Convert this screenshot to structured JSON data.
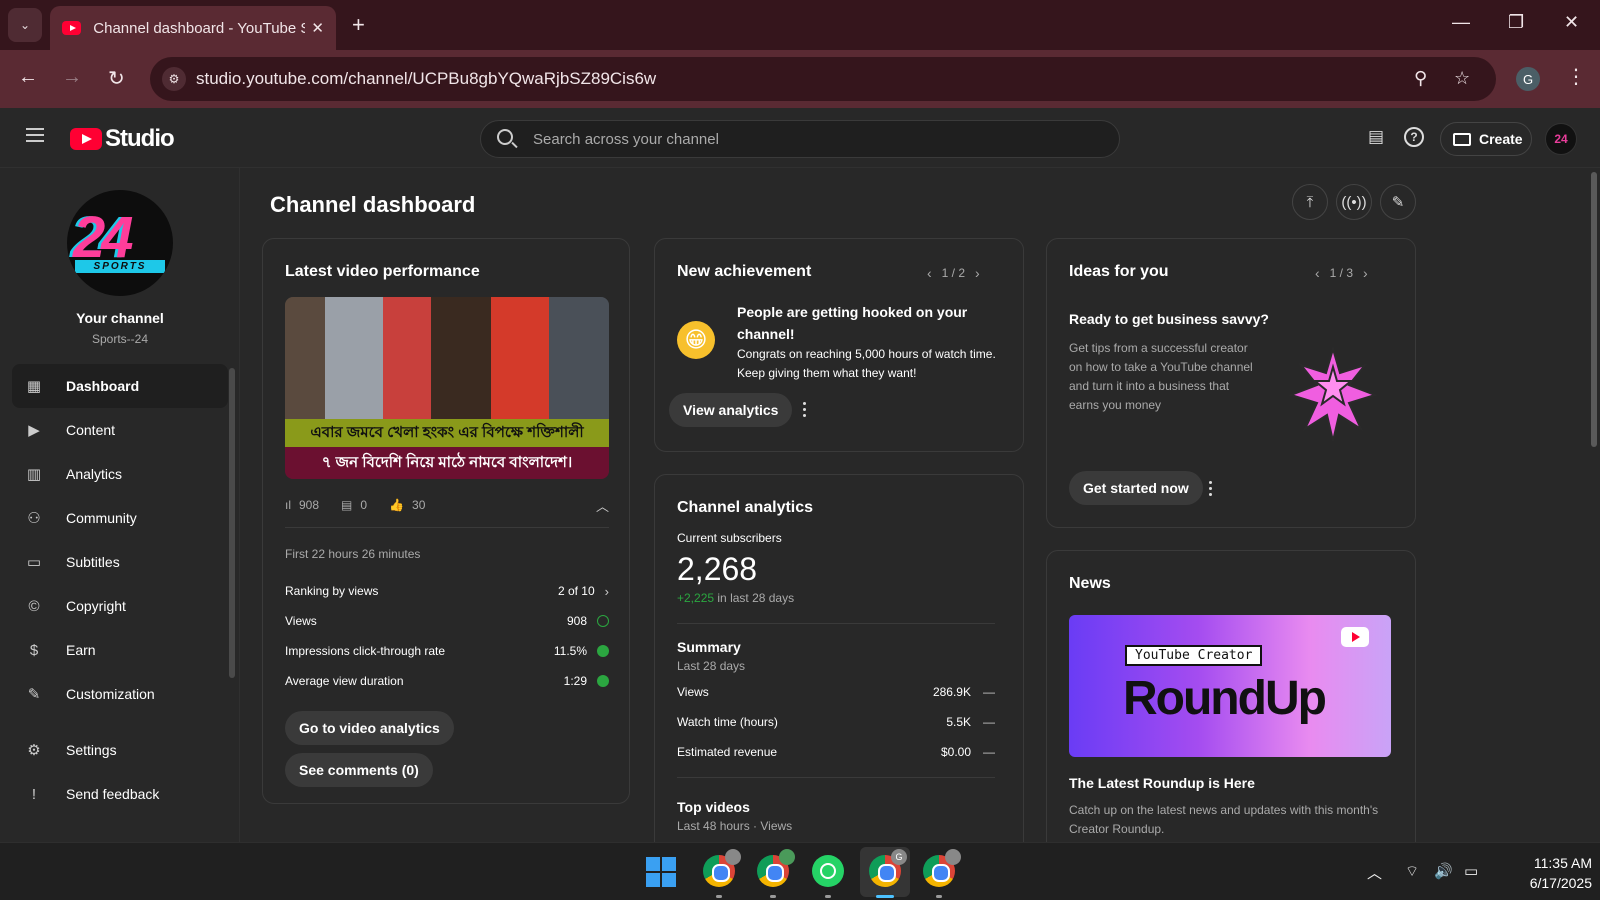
{
  "browser": {
    "tab_title": "Channel dashboard - YouTube Studio",
    "url": "studio.youtube.com/channel/UCPBu8gbYQwaRjbSZ89Cis6w",
    "profile_initial": "G"
  },
  "header": {
    "logo_text": "Studio",
    "search_placeholder": "Search across your channel",
    "create_label": "Create",
    "avatar_text": "24"
  },
  "channel": {
    "avatar_main": "24",
    "avatar_sub": "SPORTS",
    "your_channel": "Your channel",
    "name": "Sports--24"
  },
  "sidebar": {
    "items": [
      {
        "label": "Dashboard",
        "icon": "dashboard-icon"
      },
      {
        "label": "Content",
        "icon": "content-icon"
      },
      {
        "label": "Analytics",
        "icon": "analytics-icon"
      },
      {
        "label": "Community",
        "icon": "community-icon"
      },
      {
        "label": "Subtitles",
        "icon": "subtitles-icon"
      },
      {
        "label": "Copyright",
        "icon": "copyright-icon"
      },
      {
        "label": "Earn",
        "icon": "earn-icon"
      },
      {
        "label": "Customization",
        "icon": "customization-icon"
      }
    ],
    "bottom": [
      {
        "label": "Settings",
        "icon": "gear-icon"
      },
      {
        "label": "Send feedback",
        "icon": "feedback-icon"
      }
    ]
  },
  "main": {
    "title": "Channel dashboard"
  },
  "latest_video": {
    "title": "Latest video performance",
    "caption_line1": "এবার জমবে খেলা হংকং এর বিপক্ষে শক্তিশালী",
    "caption_line2": "৭ জন বিদেশি নিয়ে মাঠে নামবে বাংলাদেশ।",
    "views": "908",
    "comments": "0",
    "likes": "30",
    "period": "First 22 hours 26 minutes",
    "metrics": [
      {
        "label": "Ranking by views",
        "value": "2 of 10"
      },
      {
        "label": "Views",
        "value": "908"
      },
      {
        "label": "Impressions click-through rate",
        "value": "11.5%"
      },
      {
        "label": "Average view duration",
        "value": "1:29"
      }
    ],
    "btn_analytics": "Go to video analytics",
    "btn_comments": "See comments (0)"
  },
  "achievement": {
    "title": "New achievement",
    "pager": "1 / 2",
    "emoji": "😁",
    "headline": "People are getting hooked on your channel!",
    "body": "Congrats on reaching 5,000 hours of watch time. Keep giving them what they want!",
    "button": "View analytics"
  },
  "analytics": {
    "title": "Channel analytics",
    "subs_label": "Current subscribers",
    "subs_value": "2,268",
    "delta_value": "+2,225",
    "delta_suffix": "in last 28 days",
    "summary_title": "Summary",
    "summary_period": "Last 28 days",
    "rows": [
      {
        "label": "Views",
        "value": "286.9K",
        "trend": "—"
      },
      {
        "label": "Watch time (hours)",
        "value": "5.5K",
        "trend": "—"
      },
      {
        "label": "Estimated revenue",
        "value": "$0.00",
        "trend": "—"
      }
    ],
    "top_videos_title": "Top videos",
    "top_videos_sub": "Last 48 hours · Views"
  },
  "ideas": {
    "title": "Ideas for you",
    "pager": "1 / 3",
    "headline": "Ready to get business savvy?",
    "body": "Get tips from a successful creator on how to take a YouTube channel and turn it into a business that earns you money",
    "button": "Get started now"
  },
  "news": {
    "title": "News",
    "img_badge": "YouTube Creator",
    "img_title": "RoundUp",
    "headline": "The Latest Roundup is Here",
    "body": "Catch up on the latest news and updates with this month's Creator Roundup."
  },
  "taskbar": {
    "badge_g": "G",
    "time": "11:35 AM",
    "date": "6/17/2025"
  },
  "colors": {
    "accent_green": "#2ba640",
    "brand_red": "#ff0033",
    "browser_frame": "#5a2a33"
  }
}
